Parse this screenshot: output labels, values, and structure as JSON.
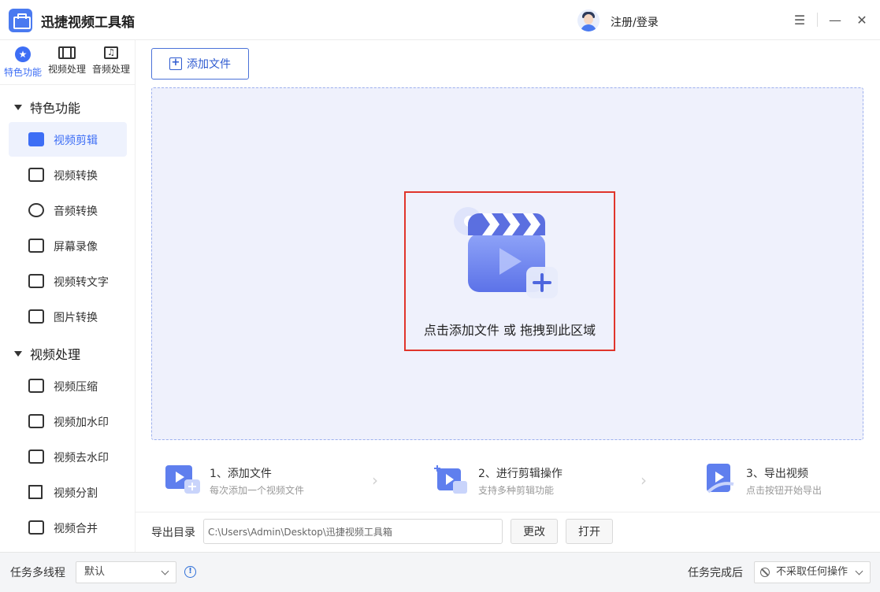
{
  "app": {
    "title": "迅捷视频工具箱",
    "login": "注册/登录"
  },
  "window_controls": {
    "menu": "☰",
    "minimize": "—",
    "close": "✕"
  },
  "top_tabs": [
    {
      "label": "特色功能",
      "icon": "star-icon",
      "active": true
    },
    {
      "label": "视频处理",
      "icon": "film-icon",
      "active": false
    },
    {
      "label": "音频处理",
      "icon": "music-icon",
      "active": false
    }
  ],
  "sidebar": {
    "section1": "特色功能",
    "features": [
      {
        "label": "视频剪辑",
        "icon": "video-edit-icon",
        "active": true
      },
      {
        "label": "视频转换",
        "icon": "video-convert-icon"
      },
      {
        "label": "音频转换",
        "icon": "audio-convert-icon"
      },
      {
        "label": "屏幕录像",
        "icon": "screen-record-icon"
      },
      {
        "label": "视频转文字",
        "icon": "video-to-text-icon"
      },
      {
        "label": "图片转换",
        "icon": "image-convert-icon"
      }
    ],
    "section2": "视频处理",
    "processing": [
      {
        "label": "视频压缩",
        "icon": "compress-icon"
      },
      {
        "label": "视频加水印",
        "icon": "add-watermark-icon"
      },
      {
        "label": "视频去水印",
        "icon": "remove-watermark-icon"
      },
      {
        "label": "视频分割",
        "icon": "split-icon"
      },
      {
        "label": "视频合并",
        "icon": "merge-icon"
      }
    ]
  },
  "main": {
    "add_file_button": "添加文件",
    "drop_text": "点击添加文件 或 拖拽到此区域",
    "steps": [
      {
        "title": "1、添加文件",
        "desc": "每次添加一个视频文件"
      },
      {
        "title": "2、进行剪辑操作",
        "desc": "支持多种剪辑功能"
      },
      {
        "title": "3、导出视频",
        "desc": "点击按钮开始导出"
      }
    ],
    "export": {
      "label": "导出目录",
      "path": "C:\\Users\\Admin\\Desktop\\迅捷视频工具箱",
      "change": "更改",
      "open": "打开"
    }
  },
  "statusbar": {
    "threads_label": "任务多线程",
    "threads_value": "默认",
    "after_label": "任务完成后",
    "after_value": "不采取任何操作"
  },
  "colors": {
    "accent": "#3d6ef5",
    "dropzone": "#eff1fc",
    "highlight": "#e0352b"
  }
}
